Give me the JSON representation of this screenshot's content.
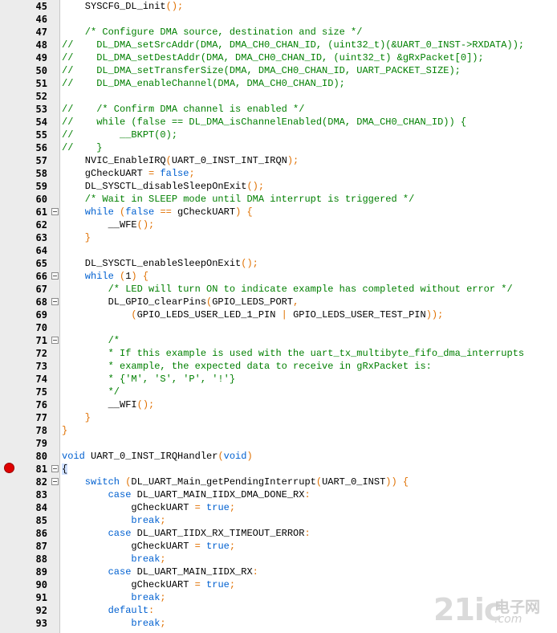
{
  "editor": {
    "lines": [
      {
        "num": "45",
        "fold": false,
        "code": [
          [
            "n",
            "    SYSCFG_DL_init"
          ],
          [
            "p",
            "();"
          ]
        ]
      },
      {
        "num": "46",
        "fold": false,
        "code": []
      },
      {
        "num": "47",
        "fold": false,
        "code": [
          [
            "c",
            "    /* Configure DMA source, destination and size */"
          ]
        ]
      },
      {
        "num": "48",
        "fold": false,
        "code": [
          [
            "c",
            "//    DL_DMA_setSrcAddr(DMA, DMA_CH0_CHAN_ID, (uint32_t)(&UART_0_INST->RXDATA));"
          ]
        ]
      },
      {
        "num": "49",
        "fold": false,
        "code": [
          [
            "c",
            "//    DL_DMA_setDestAddr(DMA, DMA_CH0_CHAN_ID, (uint32_t) &gRxPacket[0]);"
          ]
        ]
      },
      {
        "num": "50",
        "fold": false,
        "code": [
          [
            "c",
            "//    DL_DMA_setTransferSize(DMA, DMA_CH0_CHAN_ID, UART_PACKET_SIZE);"
          ]
        ]
      },
      {
        "num": "51",
        "fold": false,
        "code": [
          [
            "c",
            "//    DL_DMA_enableChannel(DMA, DMA_CH0_CHAN_ID);"
          ]
        ]
      },
      {
        "num": "52",
        "fold": false,
        "code": []
      },
      {
        "num": "53",
        "fold": false,
        "code": [
          [
            "c",
            "//    /* Confirm DMA channel is enabled */"
          ]
        ]
      },
      {
        "num": "54",
        "fold": false,
        "code": [
          [
            "c",
            "//    while (false == DL_DMA_isChannelEnabled(DMA, DMA_CH0_CHAN_ID)) {"
          ]
        ]
      },
      {
        "num": "55",
        "fold": false,
        "code": [
          [
            "c",
            "//        __BKPT(0);"
          ]
        ]
      },
      {
        "num": "56",
        "fold": false,
        "code": [
          [
            "c",
            "//    }"
          ]
        ]
      },
      {
        "num": "57",
        "fold": false,
        "code": [
          [
            "n",
            "    NVIC_EnableIRQ"
          ],
          [
            "p",
            "("
          ],
          [
            "n",
            "UART_0_INST_INT_IRQN"
          ],
          [
            "p",
            ");"
          ]
        ]
      },
      {
        "num": "58",
        "fold": false,
        "code": [
          [
            "n",
            "    gCheckUART "
          ],
          [
            "p",
            "= "
          ],
          [
            "k",
            "false"
          ],
          [
            "p",
            ";"
          ]
        ]
      },
      {
        "num": "59",
        "fold": false,
        "code": [
          [
            "n",
            "    DL_SYSCTL_disableSleepOnExit"
          ],
          [
            "p",
            "();"
          ]
        ]
      },
      {
        "num": "60",
        "fold": false,
        "code": [
          [
            "c",
            "    /* Wait in SLEEP mode until DMA interrupt is triggered */"
          ]
        ]
      },
      {
        "num": "61",
        "fold": true,
        "code": [
          [
            "k",
            "    while "
          ],
          [
            "p",
            "("
          ],
          [
            "k",
            "false "
          ],
          [
            "p",
            "== "
          ],
          [
            "n",
            "gCheckUART"
          ],
          [
            "p",
            ") {"
          ]
        ]
      },
      {
        "num": "62",
        "fold": false,
        "code": [
          [
            "n",
            "        __WFE"
          ],
          [
            "p",
            "();"
          ]
        ]
      },
      {
        "num": "63",
        "fold": false,
        "code": [
          [
            "p",
            "    }"
          ]
        ]
      },
      {
        "num": "64",
        "fold": false,
        "code": []
      },
      {
        "num": "65",
        "fold": false,
        "code": [
          [
            "n",
            "    DL_SYSCTL_enableSleepOnExit"
          ],
          [
            "p",
            "();"
          ]
        ]
      },
      {
        "num": "66",
        "fold": true,
        "code": [
          [
            "k",
            "    while "
          ],
          [
            "p",
            "("
          ],
          [
            "n",
            "1"
          ],
          [
            "p",
            ") {"
          ]
        ]
      },
      {
        "num": "67",
        "fold": false,
        "code": [
          [
            "c",
            "        /* LED will turn ON to indicate example has completed without error */"
          ]
        ]
      },
      {
        "num": "68",
        "fold": true,
        "code": [
          [
            "n",
            "        DL_GPIO_clearPins"
          ],
          [
            "p",
            "("
          ],
          [
            "n",
            "GPIO_LEDS_PORT"
          ],
          [
            "p",
            ","
          ]
        ]
      },
      {
        "num": "69",
        "fold": false,
        "code": [
          [
            "p",
            "            ("
          ],
          [
            "n",
            "GPIO_LEDS_USER_LED_1_PIN "
          ],
          [
            "p",
            "| "
          ],
          [
            "n",
            "GPIO_LEDS_USER_TEST_PIN"
          ],
          [
            "p",
            "));"
          ]
        ]
      },
      {
        "num": "70",
        "fold": false,
        "code": []
      },
      {
        "num": "71",
        "fold": true,
        "code": [
          [
            "c",
            "        /*"
          ]
        ]
      },
      {
        "num": "72",
        "fold": false,
        "code": [
          [
            "c",
            "        * If this example is used with the uart_tx_multibyte_fifo_dma_interrupts"
          ]
        ]
      },
      {
        "num": "73",
        "fold": false,
        "code": [
          [
            "c",
            "        * example, the expected data to receive in gRxPacket is:"
          ]
        ]
      },
      {
        "num": "74",
        "fold": false,
        "code": [
          [
            "c",
            "        * {'M', 'S', 'P', '!'}"
          ]
        ]
      },
      {
        "num": "75",
        "fold": false,
        "code": [
          [
            "c",
            "        */"
          ]
        ]
      },
      {
        "num": "76",
        "fold": false,
        "code": [
          [
            "n",
            "        __WFI"
          ],
          [
            "p",
            "();"
          ]
        ]
      },
      {
        "num": "77",
        "fold": false,
        "code": [
          [
            "p",
            "    }"
          ]
        ]
      },
      {
        "num": "78",
        "fold": false,
        "code": [
          [
            "p",
            "}"
          ]
        ]
      },
      {
        "num": "79",
        "fold": false,
        "code": []
      },
      {
        "num": "80",
        "fold": false,
        "code": [
          [
            "k",
            "void "
          ],
          [
            "n",
            "UART_0_INST_IRQHandler"
          ],
          [
            "p",
            "("
          ],
          [
            "k",
            "void"
          ],
          [
            "p",
            ")"
          ]
        ]
      },
      {
        "num": "81",
        "fold": true,
        "code": [
          [
            "h",
            "{"
          ]
        ]
      },
      {
        "num": "82",
        "fold": true,
        "code": [
          [
            "k",
            "    switch "
          ],
          [
            "p",
            "("
          ],
          [
            "n",
            "DL_UART_Main_getPendingInterrupt"
          ],
          [
            "p",
            "("
          ],
          [
            "n",
            "UART_0_INST"
          ],
          [
            "p",
            ")) {"
          ]
        ]
      },
      {
        "num": "83",
        "fold": false,
        "code": [
          [
            "k",
            "        case "
          ],
          [
            "n",
            "DL_UART_MAIN_IIDX_DMA_DONE_RX"
          ],
          [
            "p",
            ":"
          ]
        ]
      },
      {
        "num": "84",
        "fold": false,
        "code": [
          [
            "n",
            "            gCheckUART "
          ],
          [
            "p",
            "= "
          ],
          [
            "k",
            "true"
          ],
          [
            "p",
            ";"
          ]
        ]
      },
      {
        "num": "85",
        "fold": false,
        "code": [
          [
            "k",
            "            break"
          ],
          [
            "p",
            ";"
          ]
        ]
      },
      {
        "num": "86",
        "fold": false,
        "code": [
          [
            "k",
            "        case "
          ],
          [
            "n",
            "DL_UART_IIDX_RX_TIMEOUT_ERROR"
          ],
          [
            "p",
            ":"
          ]
        ]
      },
      {
        "num": "87",
        "fold": false,
        "code": [
          [
            "n",
            "            gCheckUART "
          ],
          [
            "p",
            "= "
          ],
          [
            "k",
            "true"
          ],
          [
            "p",
            ";"
          ]
        ]
      },
      {
        "num": "88",
        "fold": false,
        "code": [
          [
            "k",
            "            break"
          ],
          [
            "p",
            ";"
          ]
        ]
      },
      {
        "num": "89",
        "fold": false,
        "code": [
          [
            "k",
            "        case "
          ],
          [
            "n",
            "DL_UART_MAIN_IIDX_RX"
          ],
          [
            "p",
            ":"
          ]
        ]
      },
      {
        "num": "90",
        "fold": false,
        "code": [
          [
            "n",
            "            gCheckUART "
          ],
          [
            "p",
            "= "
          ],
          [
            "k",
            "true"
          ],
          [
            "p",
            ";"
          ]
        ]
      },
      {
        "num": "91",
        "fold": false,
        "code": [
          [
            "k",
            "            break"
          ],
          [
            "p",
            ";"
          ]
        ]
      },
      {
        "num": "92",
        "fold": false,
        "code": [
          [
            "k",
            "        default"
          ],
          [
            "p",
            ":"
          ]
        ]
      },
      {
        "num": "93",
        "fold": false,
        "code": [
          [
            "k",
            "            break"
          ],
          [
            "p",
            ";"
          ]
        ]
      }
    ],
    "breakpoint_line": "81"
  },
  "watermark": {
    "brand": "21ic",
    "cn": "电子网",
    "domain": ".com"
  }
}
